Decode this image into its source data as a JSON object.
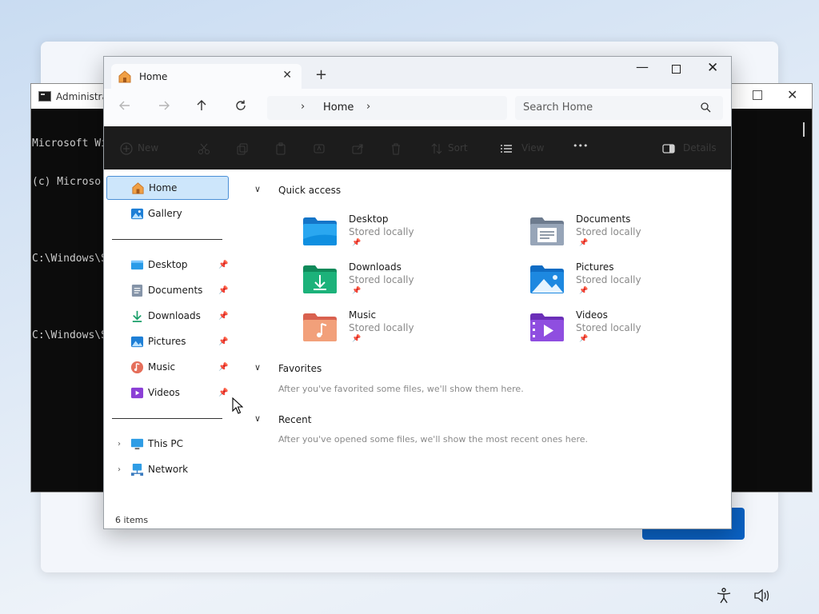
{
  "cmd": {
    "title": "Administrat",
    "lines": [
      "Microsoft Wi",
      "(c) Microso",
      "",
      "C:\\Windows\\S",
      "",
      "C:\\Windows\\S"
    ]
  },
  "tab": {
    "label": "Home",
    "close_glyph": "✕",
    "new_glyph": "+"
  },
  "window": {
    "min_glyph": "—",
    "close_glyph": "✕"
  },
  "address": {
    "crumb": "Home"
  },
  "search": {
    "placeholder": "Search Home"
  },
  "commandbar": {
    "new_label": "New",
    "sort_label": "Sort",
    "view_label": "View",
    "more_glyph": "•••",
    "details_label": "Details"
  },
  "sidebar": {
    "top": [
      {
        "label": "Home",
        "icon": "home-icon"
      },
      {
        "label": "Gallery",
        "icon": "gallery-icon"
      }
    ],
    "pinned": [
      {
        "label": "Desktop",
        "icon": "desktop-folder-icon"
      },
      {
        "label": "Documents",
        "icon": "documents-folder-icon"
      },
      {
        "label": "Downloads",
        "icon": "downloads-folder-icon"
      },
      {
        "label": "Pictures",
        "icon": "pictures-folder-icon"
      },
      {
        "label": "Music",
        "icon": "music-folder-icon"
      },
      {
        "label": "Videos",
        "icon": "videos-folder-icon"
      }
    ],
    "bottom": [
      {
        "label": "This PC",
        "icon": "this-pc-icon"
      },
      {
        "label": "Network",
        "icon": "network-icon"
      }
    ]
  },
  "quick_access": {
    "title": "Quick access",
    "items": [
      {
        "name": "Desktop",
        "sub": "Stored locally",
        "icon": "desktop-folder-icon"
      },
      {
        "name": "Documents",
        "sub": "Stored locally",
        "icon": "documents-folder-icon"
      },
      {
        "name": "Downloads",
        "sub": "Stored locally",
        "icon": "downloads-folder-icon"
      },
      {
        "name": "Pictures",
        "sub": "Stored locally",
        "icon": "pictures-folder-icon"
      },
      {
        "name": "Music",
        "sub": "Stored locally",
        "icon": "music-folder-icon"
      },
      {
        "name": "Videos",
        "sub": "Stored locally",
        "icon": "videos-folder-icon"
      }
    ]
  },
  "favorites": {
    "title": "Favorites",
    "desc": "After you've favorited some files, we'll show them here."
  },
  "recent": {
    "title": "Recent",
    "desc": "After you've opened some files, we'll show the most recent ones here."
  },
  "status": {
    "count": "6 items"
  },
  "colors": {
    "accent": "#0a62c4",
    "selection": "#cde6fb",
    "commandbar": "#1c1c1c"
  }
}
